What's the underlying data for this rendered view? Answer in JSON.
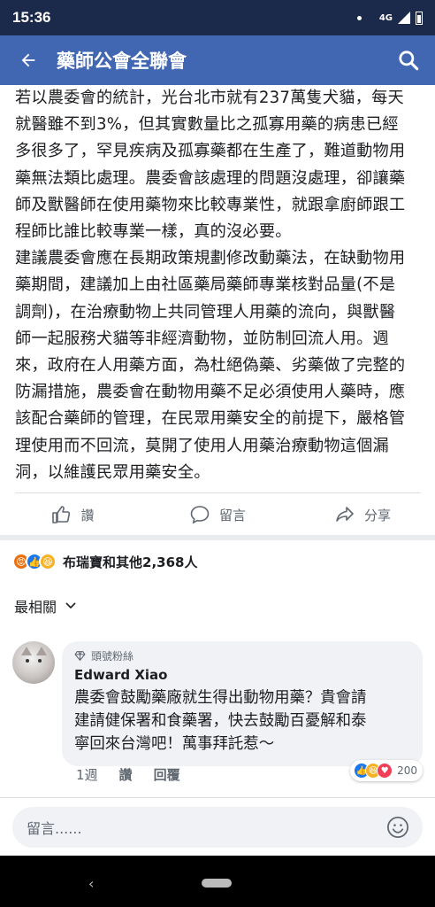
{
  "status_bar": {
    "time": "15:36",
    "network": "4G"
  },
  "header": {
    "title": "藥師公會全聯會",
    "back_icon": "arrow-left-icon",
    "search_icon": "search-icon"
  },
  "post": {
    "paragraphs": [
      "若以農委會的統計，光台北市就有237萬隻犬貓，每天\n就醫雖不到3%，但其實數量比之孤寡用藥的病患已經\n多很多了，罕見疾病及孤寡藥都在生產了，難道動物用\n藥無法類比處理。農委會該處理的問題沒處理，卻讓藥\n師及獸醫師在使用藥物來比較專業性，就跟拿廚師跟工\n程師比誰比較專業一樣，真的沒必要。",
      "建議農委會應在長期政策規劃修改動藥法，在缺動物用\n藥期間，建議加上由社區藥局藥師專業核對品量(不是\n調劑)，在治療動物上共同管理人用藥的流向，與獸醫\n師一起服務犬貓等非經濟動物，並防制回流人用。週\n來，政府在人用藥方面，為杜絕偽藥、劣藥做了完整的\n防漏措施，農委會在動物用藥不足必須使用人藥時，應\n該配合藥師的管理，在民眾用藥安全的前提下，嚴格管\n理使用而不回流，莫開了使用人用藥治療動物這個漏\n洞，以維護民眾用藥安全。"
    ]
  },
  "actions": {
    "like": "讚",
    "comment": "留言",
    "share": "分享"
  },
  "reactions": {
    "summary": "布瑞寶和其他2,368人",
    "icons": [
      "angry",
      "like",
      "haha"
    ]
  },
  "comments_sort": {
    "label": "最相關"
  },
  "comment": {
    "badge": "頭號粉絲",
    "author": "Edward Xiao",
    "text": "農委會鼓勵藥廠就生得出動物用藥？貴會請\n建請健保署和食藥署，快去鼓勵百憂解和泰\n寧回來台灣吧！萬事拜託惹〜",
    "time": "1週",
    "like": "讚",
    "reply": "回覆",
    "reaction_count": "200",
    "reaction_icons": [
      "like",
      "haha",
      "love"
    ]
  },
  "composer": {
    "placeholder": "留言......"
  },
  "colors": {
    "header_bg": "#4267b2",
    "status_bg": "#1b2a4a",
    "like_blue": "#1877f2",
    "angry": "#e9710f",
    "love": "#f33e58",
    "haha": "#f7b125"
  }
}
